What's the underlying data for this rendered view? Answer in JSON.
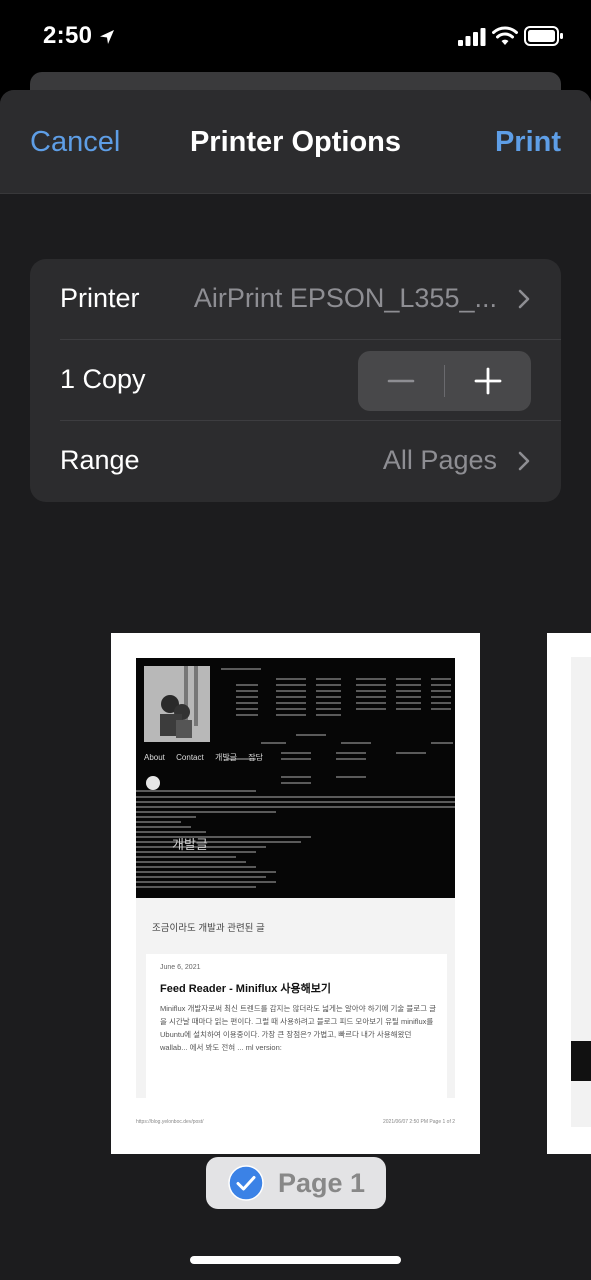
{
  "status_bar": {
    "time": "2:50",
    "icons": [
      "location-arrow-icon",
      "cellular-signal-icon",
      "wifi-icon",
      "battery-icon"
    ]
  },
  "nav": {
    "cancel_label": "Cancel",
    "title": "Printer Options",
    "print_label": "Print"
  },
  "options": {
    "printer": {
      "label": "Printer",
      "value": "AirPrint EPSON_L355_..."
    },
    "copies": {
      "label": "1 Copy",
      "minus_symbol": "−",
      "plus_symbol": "+"
    },
    "range": {
      "label": "Range",
      "value": "All Pages"
    }
  },
  "preview": {
    "nav_links": [
      "About",
      "Contact",
      "개발글",
      "잡담"
    ],
    "category_overlay": "개발글",
    "tagline": "조금이라도 개발과 관련된 글",
    "post": {
      "date": "June 6, 2021",
      "title": "Feed Reader - Miniflux 사용해보기",
      "excerpt": "Miniflux 개발자로써 최신 트렌드를 감지는 않더라도 넓게는 알아야 하기에 기술 블로그 글을 시간날 때마다 읽는 편이다. 그럴 때 사용하려고 블로그 피드 모아보기 유틸 miniflux를 Ubuntu에 설치하여 이용중이다. 가장 큰 장점은? 가볍고, 빠르다 내가 사용해왔던 wallab... 에서 봐도 전혀 ... ml version:"
    },
    "footer_left": "https://blog.yelonboc.dev/post/",
    "footer_right": "2021/06/07 2:50 PM\nPage 1 of 2",
    "badge_label": "Page 1"
  },
  "colors": {
    "accent": "#5e9ee6",
    "background": "#000000",
    "sheet": "#1c1c1e",
    "group": "#2c2c2e"
  }
}
